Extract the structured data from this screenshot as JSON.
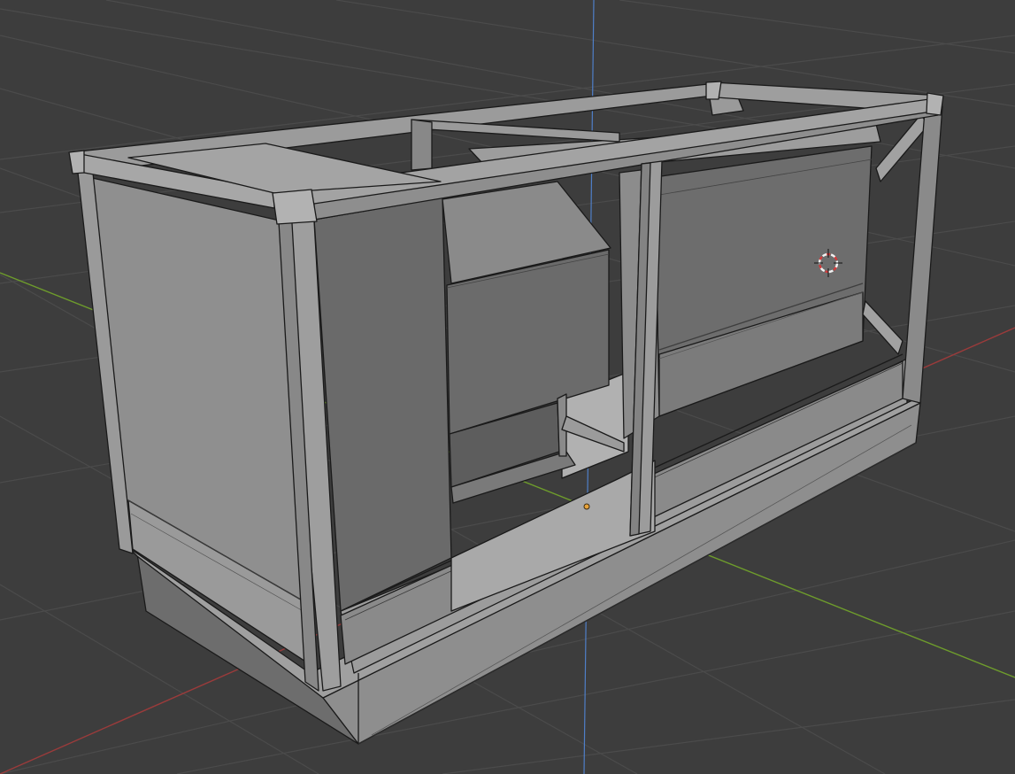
{
  "viewport": {
    "background": "#3d3d3d",
    "grid_color": "#4b4b4b",
    "x_axis_color": "#9a3b3b",
    "y_axis_color": "#6e9c2c",
    "z_axis_color": "#4f7fc8"
  },
  "scene": {
    "object_name": "",
    "shading": "solid-grey-with-wireframe-overlay",
    "edge_color": "#1a1a1a",
    "face_light": "#9a9a9a",
    "face_mid": "#7d7d7d",
    "face_dark": "#5e5e5e",
    "face_darker": "#4a4a4a"
  },
  "icons": {
    "cursor": "3d-cursor-icon",
    "origin": "object-origin-icon"
  },
  "cursor_colors": {
    "ring_red": "#d43a3a",
    "ring_white": "#f2f2f2"
  },
  "origin_color": "#e8a33a"
}
